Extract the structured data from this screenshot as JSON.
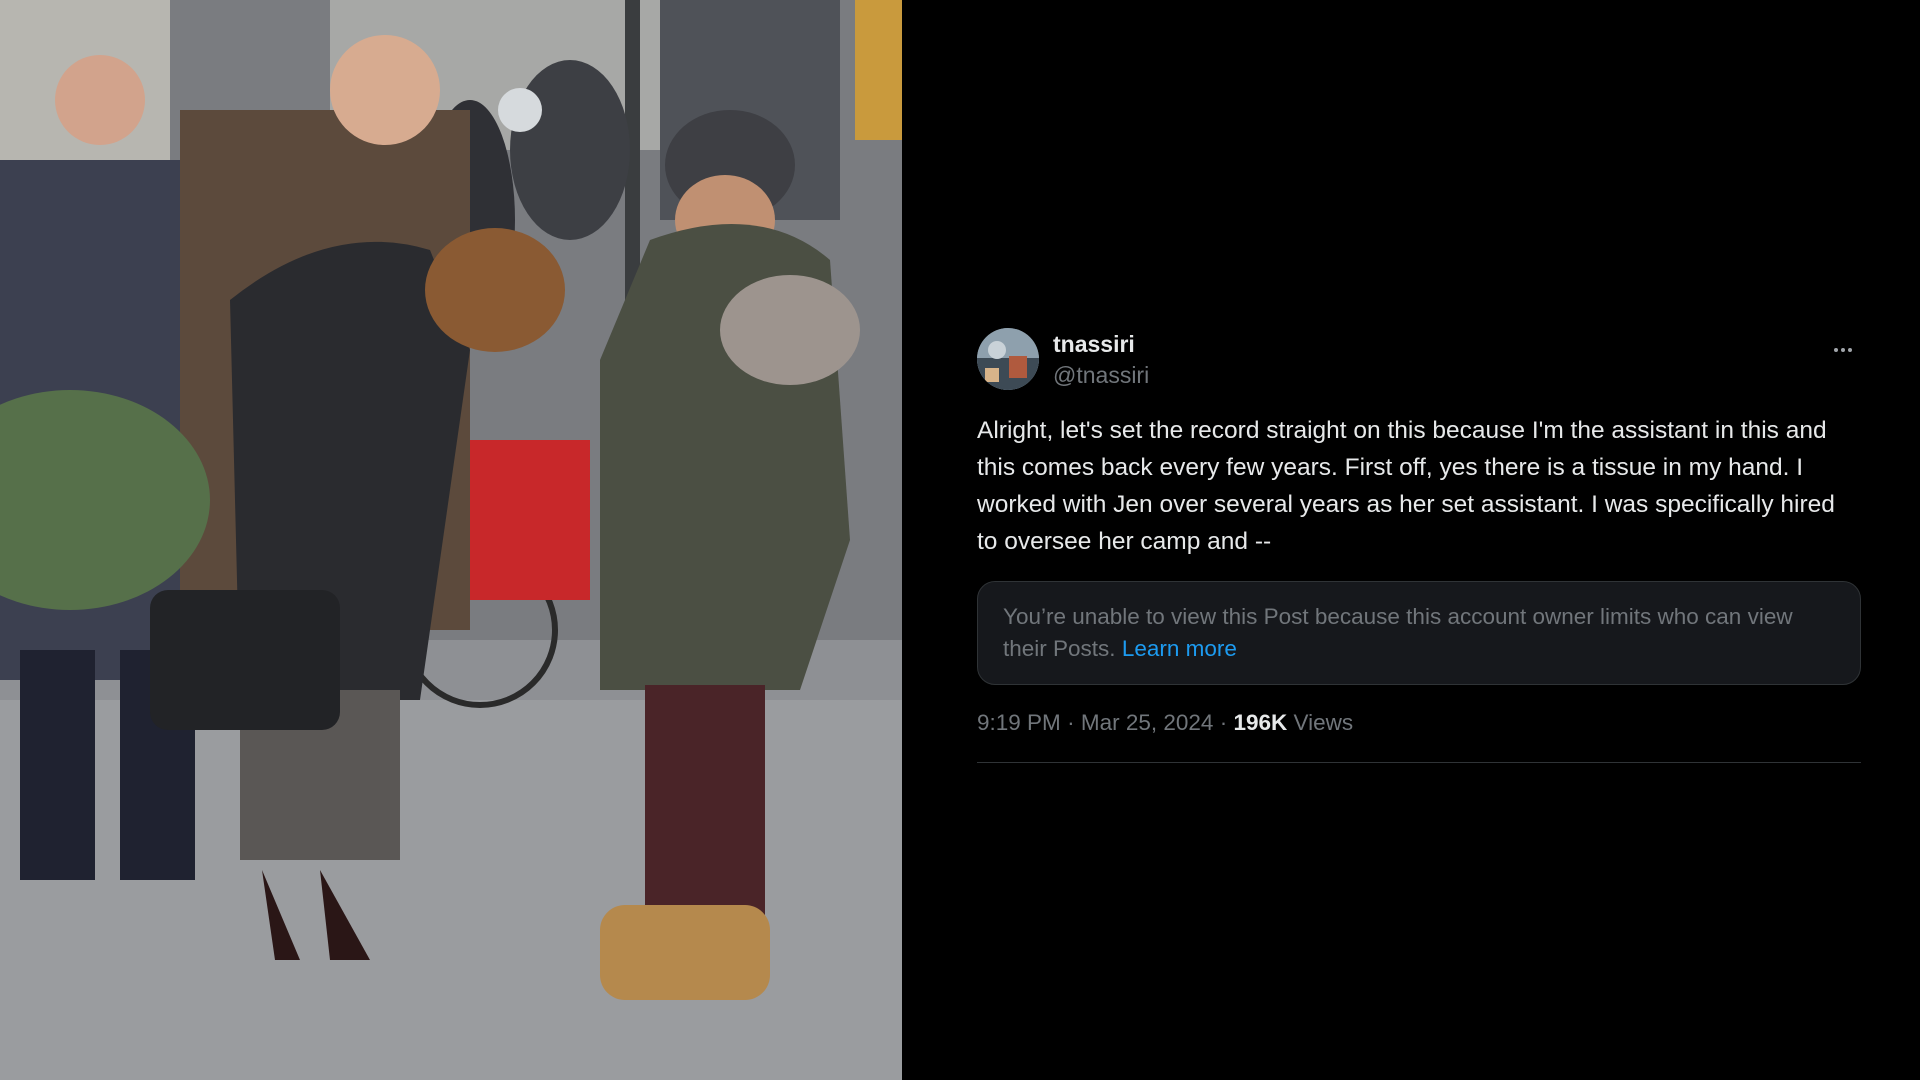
{
  "tweet": {
    "display_name": "tnassiri",
    "handle": "@tnassiri",
    "more_icon": "ellipsis-icon",
    "text": "Alright, let's set the record straight on this because I'm the assistant in this and this comes back every few years. First off, yes there is a tissue in my hand. I worked with Jen over several years as her set assistant. I was specifically hired to oversee her camp and --",
    "notice": {
      "text": "You’re unable to view this Post because this account owner limits who can view their Posts.",
      "link": "Learn more"
    },
    "time": "9:19 PM",
    "separator": "·",
    "date": "Mar 25, 2024",
    "views_count": "196K",
    "views_label": "Views"
  },
  "colors": {
    "background": "#000000",
    "text_primary": "#e7e9ea",
    "text_secondary": "#71767b",
    "link": "#1d9bf0",
    "notice_bg": "#16181c",
    "border": "#2f3336"
  }
}
